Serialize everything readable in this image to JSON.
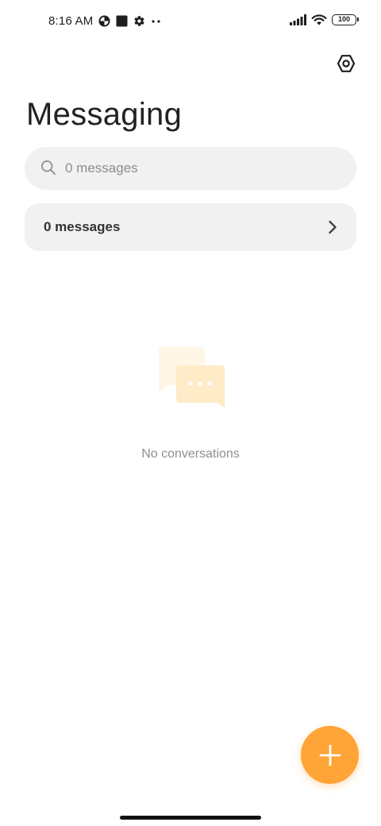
{
  "status_bar": {
    "time": "8:16 AM",
    "battery_level": "100",
    "icons": [
      "data-saver-icon",
      "square-notification-icon",
      "gear-icon",
      "more-dots-icon",
      "signal-icon",
      "wifi-icon",
      "battery-icon"
    ]
  },
  "header": {
    "title": "Messaging",
    "settings_icon": "settings-hexagon-icon"
  },
  "search": {
    "placeholder": "0 messages",
    "value": "",
    "icon": "search-icon"
  },
  "messages_row": {
    "label": "0 messages",
    "icon": "chevron-right-icon"
  },
  "empty_state": {
    "text": "No conversations",
    "icon": "chat-bubbles-icon"
  },
  "fab": {
    "icon": "plus-icon"
  },
  "colors": {
    "accent": "#ffa436",
    "surface": "#f1f1f1",
    "illustration_back": "#fff6e6",
    "illustration_front": "#ffebc8"
  }
}
